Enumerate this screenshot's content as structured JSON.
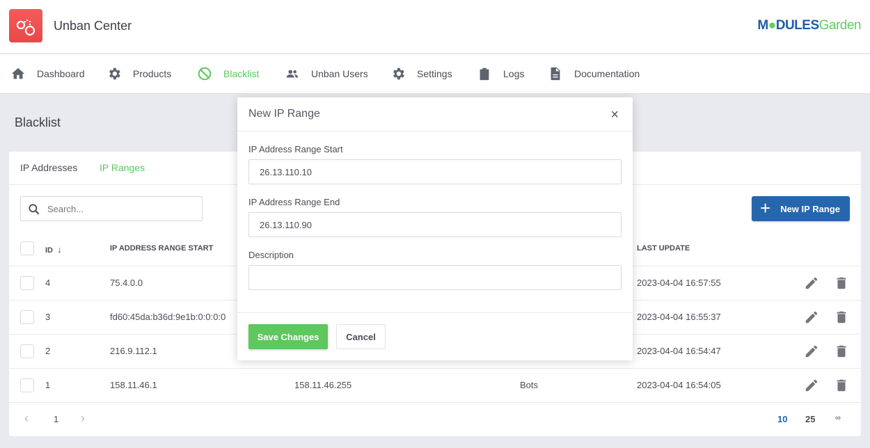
{
  "app": {
    "title": "Unban Center",
    "brand_logo": "ModulesGarden",
    "brand_part1": "M",
    "brand_part2": "DULES",
    "brand_part3": "Garden"
  },
  "nav": [
    {
      "label": "Dashboard",
      "icon": "home-icon"
    },
    {
      "label": "Products",
      "icon": "gear-icon"
    },
    {
      "label": "Blacklist",
      "icon": "block-icon",
      "active": true
    },
    {
      "label": "Unban Users",
      "icon": "users-icon"
    },
    {
      "label": "Settings",
      "icon": "gear-icon"
    },
    {
      "label": "Logs",
      "icon": "clipboard-icon"
    },
    {
      "label": "Documentation",
      "icon": "document-icon"
    }
  ],
  "page": {
    "title": "Blacklist"
  },
  "tabs": [
    {
      "label": "IP Addresses"
    },
    {
      "label": "IP Ranges",
      "active": true
    }
  ],
  "search": {
    "placeholder": "Search..."
  },
  "new_button": {
    "label": "New IP Range"
  },
  "table": {
    "headers": {
      "id": "ID",
      "start": "IP ADDRESS RANGE START",
      "last_update": "LAST UPDATE"
    },
    "rows": [
      {
        "id": "4",
        "start": "75.4.0.0",
        "end": "",
        "description": "",
        "last_update": "2023-04-04 16:57:55"
      },
      {
        "id": "3",
        "start": "fd60:45da:b36d:9e1b:0:0:0:0",
        "end": "",
        "description": "",
        "last_update": "2023-04-04 16:55:37"
      },
      {
        "id": "2",
        "start": "216.9.112.1",
        "end": "",
        "description": "",
        "last_update": "2023-04-04 16:54:47"
      },
      {
        "id": "1",
        "start": "158.11.46.1",
        "end": "158.11.46.255",
        "description": "Bots",
        "last_update": "2023-04-04 16:54:05"
      }
    ]
  },
  "pagination": {
    "prev": "‹",
    "page": "1",
    "next": "›",
    "sizes": [
      "10",
      "25",
      "∞"
    ],
    "active_size": "10"
  },
  "modal": {
    "title": "New IP Range",
    "close": "×",
    "fields": {
      "start": {
        "label": "IP Address Range Start",
        "value": "26.13.110.10"
      },
      "end": {
        "label": "IP Address Range End",
        "value": "26.13.110.90"
      },
      "description": {
        "label": "Description",
        "value": ""
      }
    },
    "save_label": "Save Changes",
    "cancel_label": "Cancel"
  },
  "colors": {
    "accent_green": "#5cc85c",
    "primary_blue": "#2566ad",
    "logo_red": "#f05252"
  }
}
